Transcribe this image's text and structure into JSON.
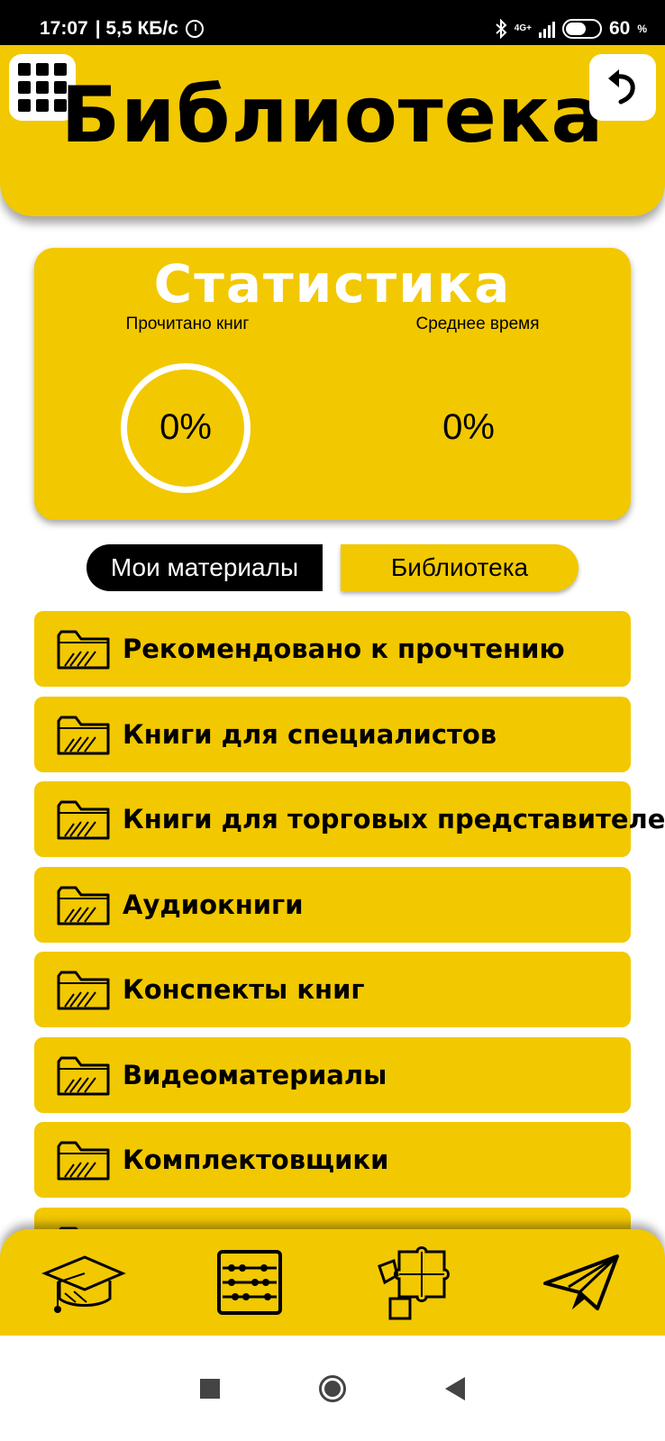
{
  "status_bar": {
    "time": "17:07",
    "speed": "| 5,5 КБ/с",
    "network": "4G+",
    "battery": "60",
    "battery_unit": "%",
    "battery_level": 0.6,
    "icons": [
      "alarm-icon",
      "bluetooth-icon",
      "signal-icon",
      "battery-icon"
    ]
  },
  "header": {
    "title": "Библиотека",
    "left_icon": "grid-menu-icon",
    "right_icon": "undo-arrow-icon"
  },
  "stats": {
    "title": "Статистика",
    "read_label": "Прочитано книг",
    "read_value": "0%",
    "avg_label": "Среднее время",
    "avg_value": "0%"
  },
  "tabs": [
    {
      "label": "Мои материалы",
      "active": true
    },
    {
      "label": "Библиотека",
      "active": false
    }
  ],
  "list": [
    {
      "label": "Рекомендовано к прочтению",
      "icon": "folder-icon"
    },
    {
      "label": "Книги для специалистов",
      "icon": "folder-icon"
    },
    {
      "label": "Книги для торговых представителей",
      "icon": "folder-icon"
    },
    {
      "label": "Аудиокниги",
      "icon": "folder-icon"
    },
    {
      "label": "Конспекты книг",
      "icon": "folder-icon"
    },
    {
      "label": "Видеоматериалы",
      "icon": "folder-icon"
    },
    {
      "label": "Комплектовщики",
      "icon": "folder-icon"
    },
    {
      "label": "",
      "icon": "folder-icon"
    }
  ],
  "bottom_nav": [
    {
      "icon": "graduation-cap-icon"
    },
    {
      "icon": "abacus-icon"
    },
    {
      "icon": "puzzle-icon"
    },
    {
      "icon": "paper-plane-icon"
    }
  ],
  "colors": {
    "accent": "#f2c800",
    "dark": "#000000",
    "light": "#ffffff"
  }
}
